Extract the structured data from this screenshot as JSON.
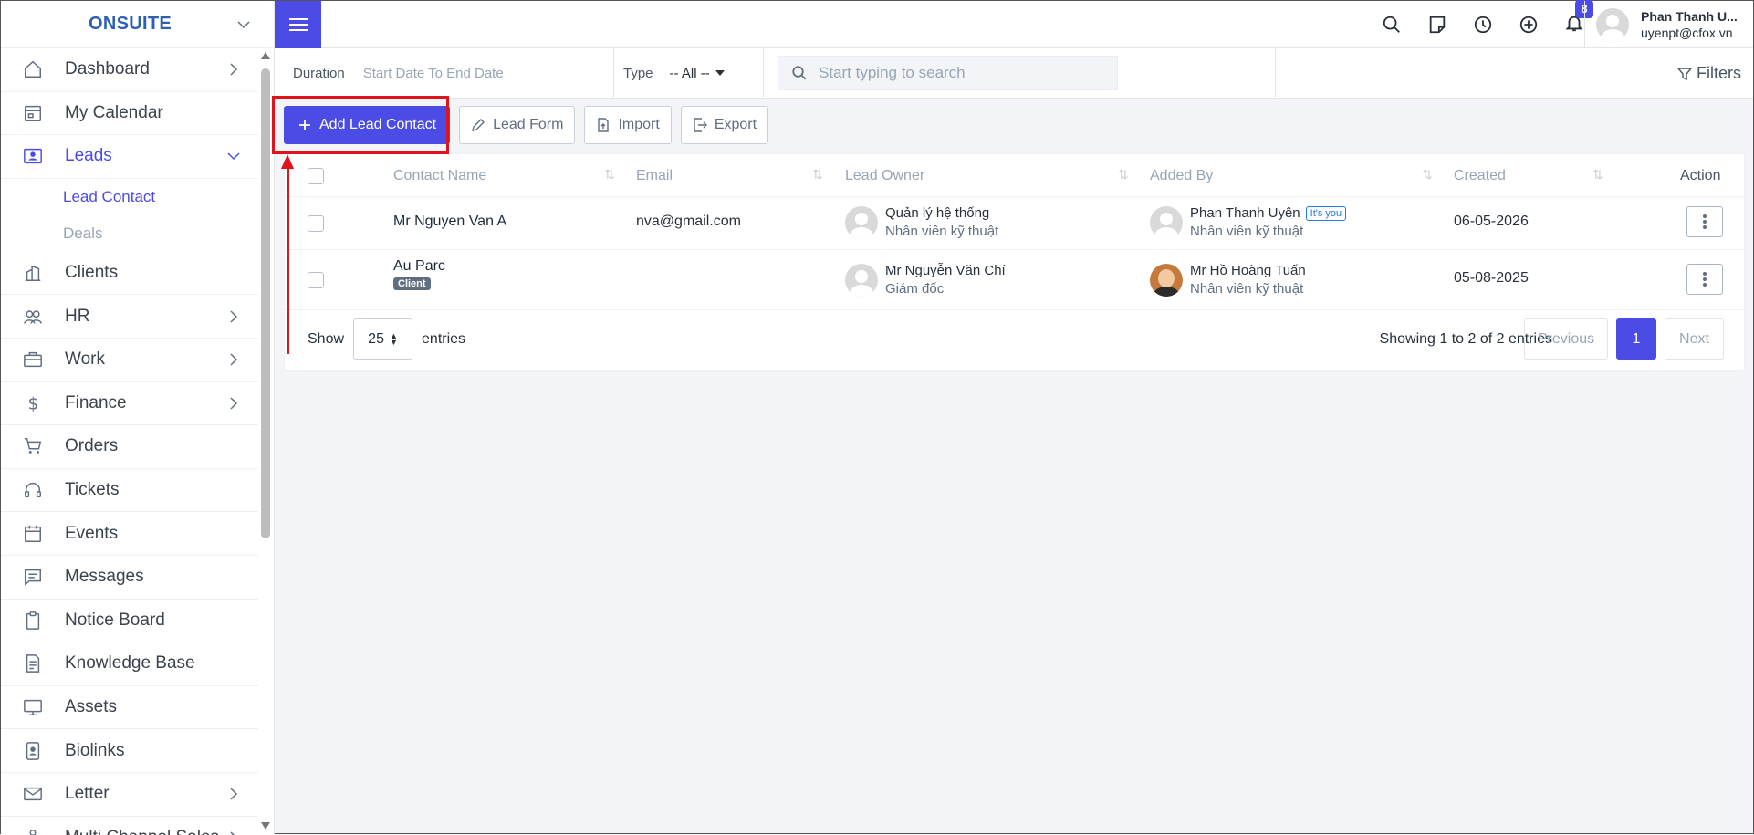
{
  "brand": "ONSUITE",
  "sidebar": {
    "items": [
      {
        "label": "Dashboard",
        "icon": "home-icon",
        "chevron": true
      },
      {
        "label": "My Calendar",
        "icon": "calendar-icon",
        "chevron": false
      },
      {
        "label": "Leads",
        "icon": "leads-icon",
        "chevron": true,
        "expanded": true
      },
      {
        "label": "Clients",
        "icon": "building-icon",
        "chevron": false
      },
      {
        "label": "HR",
        "icon": "users-icon",
        "chevron": true
      },
      {
        "label": "Work",
        "icon": "briefcase-icon",
        "chevron": true
      },
      {
        "label": "Finance",
        "icon": "dollar-icon",
        "chevron": true
      },
      {
        "label": "Orders",
        "icon": "cart-icon",
        "chevron": false
      },
      {
        "label": "Tickets",
        "icon": "headset-icon",
        "chevron": false
      },
      {
        "label": "Events",
        "icon": "event-calendar-icon",
        "chevron": false
      },
      {
        "label": "Messages",
        "icon": "message-icon",
        "chevron": false
      },
      {
        "label": "Notice Board",
        "icon": "clipboard-icon",
        "chevron": false
      },
      {
        "label": "Knowledge Base",
        "icon": "document-icon",
        "chevron": false
      },
      {
        "label": "Assets",
        "icon": "monitor-icon",
        "chevron": false
      },
      {
        "label": "Biolinks",
        "icon": "id-card-icon",
        "chevron": false
      },
      {
        "label": "Letter",
        "icon": "mail-icon",
        "chevron": true
      },
      {
        "label": "Multi Channel Sales",
        "icon": "channel-icon",
        "chevron": true
      }
    ],
    "subitems": [
      {
        "label": "Lead Contact",
        "active": true
      },
      {
        "label": "Deals",
        "active": false
      }
    ]
  },
  "topbar": {
    "notification_count": "8",
    "user_name": "Phan Thanh U...",
    "user_email": "uyenpt@cfox.vn"
  },
  "filters": {
    "duration_label": "Duration",
    "duration_value": "Start Date To End Date",
    "type_label": "Type",
    "type_value": "-- All --",
    "search_placeholder": "Start typing to search",
    "filters_label": "Filters"
  },
  "actions": {
    "add": "Add Lead Contact",
    "lead_form": "Lead Form",
    "import": "Import",
    "export": "Export"
  },
  "table": {
    "columns": [
      "Contact Name",
      "Email",
      "Lead Owner",
      "Added By",
      "Created",
      "Action"
    ],
    "rows": [
      {
        "name": "Mr Nguyen Van A",
        "tag": "",
        "email": "nva@gmail.com",
        "owner_name": "Quản lý hệ thống",
        "owner_role": "Nhân viên kỹ thuật",
        "added_name": "Phan Thanh Uyên",
        "added_badge": "It's you",
        "added_role": "Nhân viên kỹ thuật",
        "created": "06-05-2026"
      },
      {
        "name": "Au Parc",
        "tag": "Client",
        "email": "",
        "owner_name": "Mr Nguyễn Văn Chí",
        "owner_role": "Giám đốc",
        "added_name": "Mr Hồ Hoàng Tuấn",
        "added_badge": "",
        "added_role": "Nhân viên kỹ thuật",
        "created": "05-08-2025"
      }
    ]
  },
  "pagination": {
    "show_label": "Show",
    "entries_value": "25",
    "entries_label": "entries",
    "info": "Showing 1 to 2 of 2 entries",
    "previous": "Previous",
    "current": "1",
    "next": "Next"
  },
  "colors": {
    "accent": "#4b4ce6",
    "highlight": "#e0121b"
  }
}
